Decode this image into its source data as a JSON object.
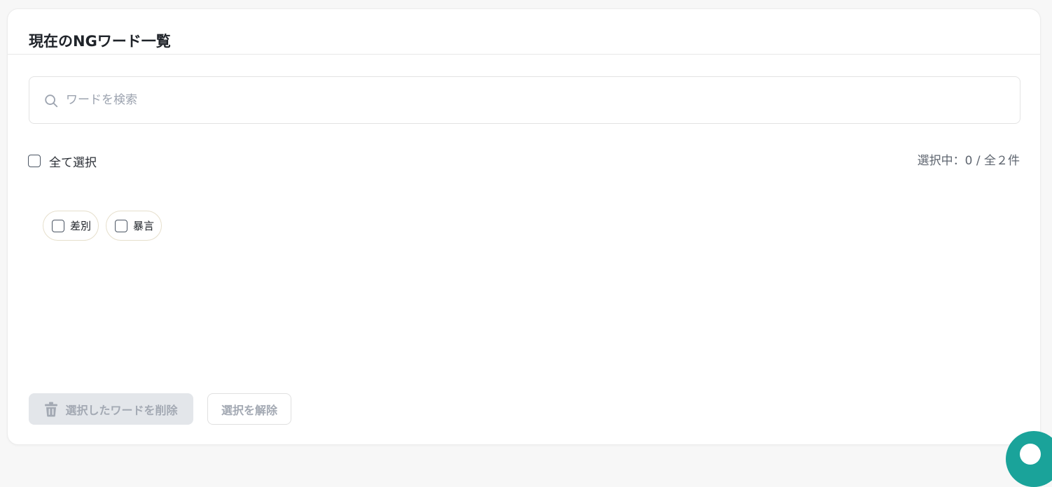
{
  "panel": {
    "title": "現在のNGワード一覧"
  },
  "search": {
    "placeholder": "ワードを検索",
    "value": "",
    "icon": "search-icon"
  },
  "select_all": {
    "label": "全て選択",
    "checked": false
  },
  "selection_status": {
    "text": "選択中：0 / 全２件",
    "selected": 0,
    "total": 2
  },
  "words": [
    {
      "label": "差別",
      "checked": false
    },
    {
      "label": "暴言",
      "checked": false
    }
  ],
  "actions": {
    "delete_label": "選択したワードを削除",
    "delete_icon": "trash-icon",
    "clear_label": "選択を解除"
  },
  "colors": {
    "accent": "#1aa39a",
    "disabled_bg": "#e3e6ea",
    "disabled_text": "#a3a9b3",
    "tag_border": "#e6dfcc"
  }
}
